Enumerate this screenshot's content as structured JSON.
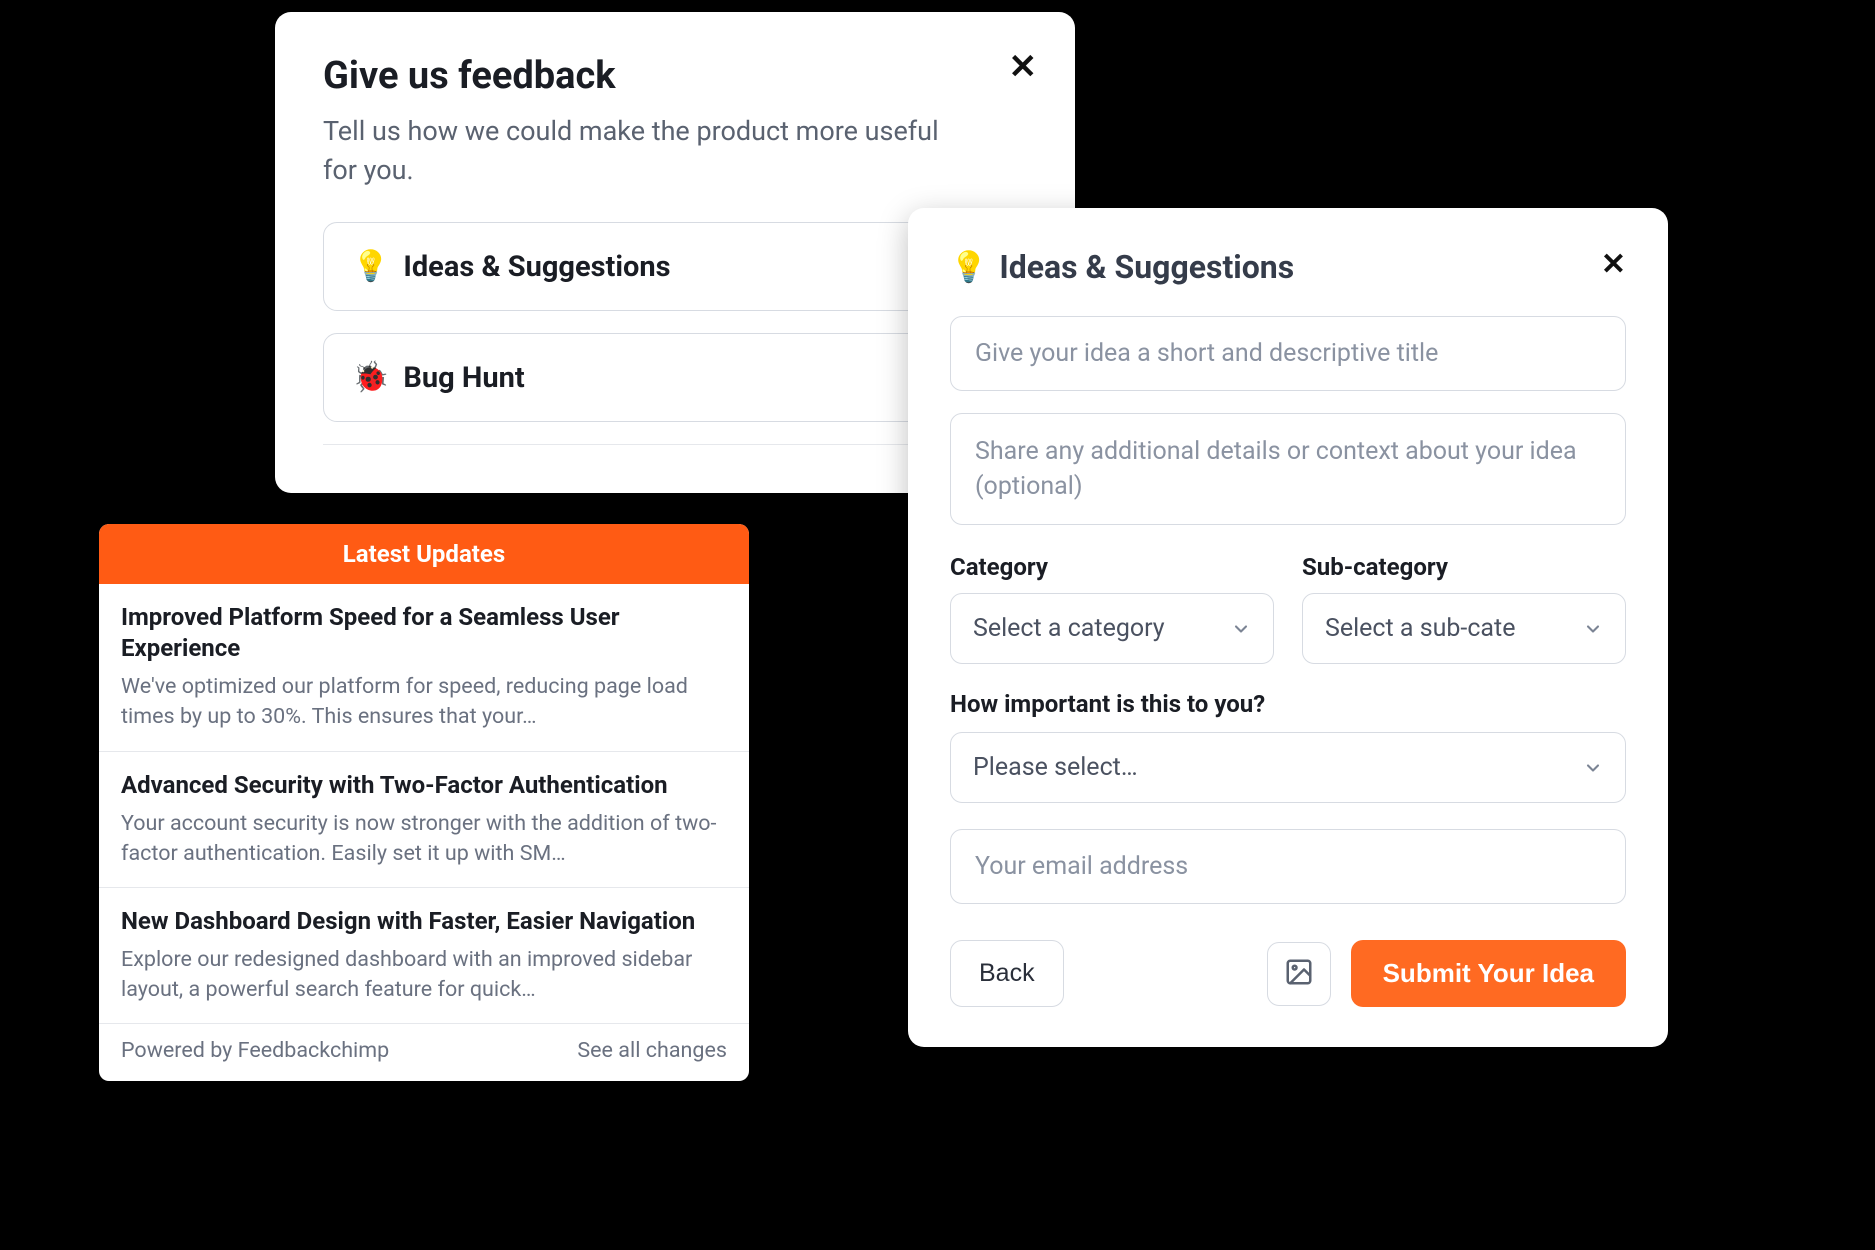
{
  "feedback": {
    "title": "Give us feedback",
    "subtitle": "Tell us how we could make the product more useful for you.",
    "options": [
      {
        "icon": "💡",
        "label": "Ideas & Suggestions"
      },
      {
        "icon": "🐞",
        "label": "Bug Hunt"
      }
    ]
  },
  "updates": {
    "header": "Latest Updates",
    "items": [
      {
        "title": "Improved Platform Speed for a Seamless User Experience",
        "desc": "We've optimized our platform for speed, reducing page load times by up to 30%. This ensures that your…"
      },
      {
        "title": "Advanced Security with Two-Factor Authentication",
        "desc": "Your account security is now stronger with the addition of two-factor authentication. Easily set it up with SM…"
      },
      {
        "title": "New Dashboard Design with Faster, Easier Navigation",
        "desc": "Explore our redesigned dashboard with an improved sidebar layout, a powerful search feature for quick…"
      }
    ],
    "powered_by": "Powered by Feedbackchimp",
    "see_all": "See all changes"
  },
  "form": {
    "heading_icon": "💡",
    "heading": "Ideas & Suggestions",
    "title_placeholder": "Give your idea a short and descriptive title",
    "details_placeholder": "Share any additional details or context about your idea (optional)",
    "category_label": "Category",
    "category_placeholder": "Select a category",
    "subcategory_label": "Sub-category",
    "subcategory_placeholder": "Select a sub-cate",
    "importance_label": "How important is this to you?",
    "importance_placeholder": "Please select…",
    "email_placeholder": "Your email address",
    "back": "Back",
    "submit": "Submit Your Idea"
  },
  "colors": {
    "accent": "#ff5b14",
    "accent_btn": "#ff6a22"
  }
}
